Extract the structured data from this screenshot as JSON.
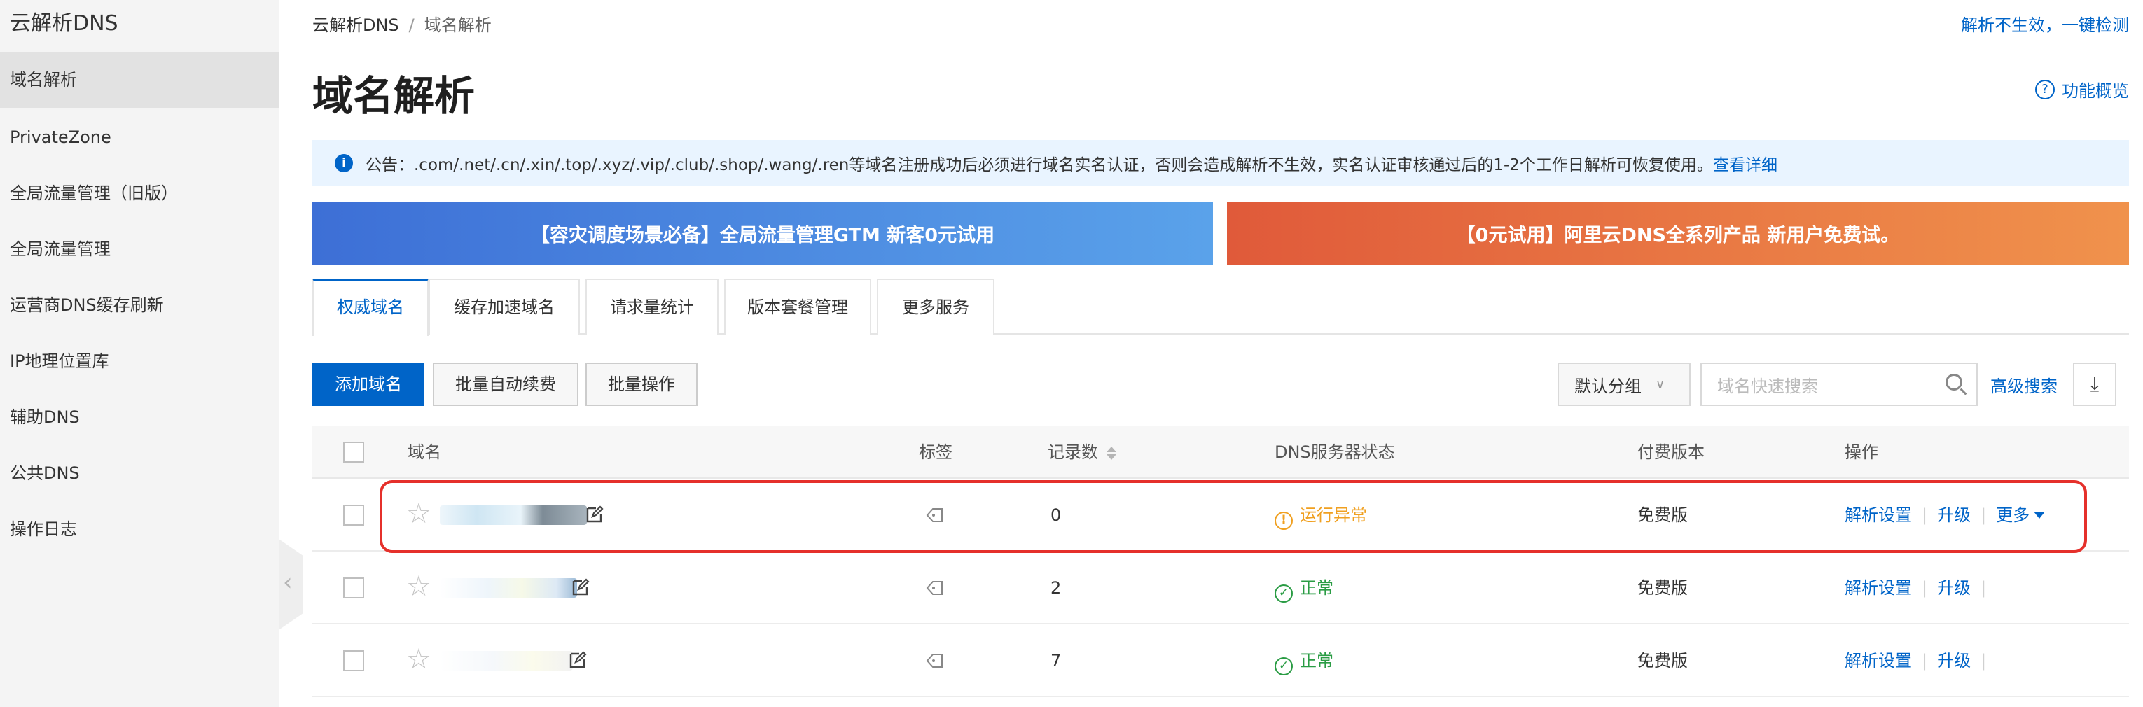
{
  "sidebar": {
    "title": "云解析DNS",
    "items": [
      {
        "label": "域名解析",
        "active": true
      },
      {
        "label": "PrivateZone"
      },
      {
        "label": "全局流量管理（旧版）"
      },
      {
        "label": "全局流量管理"
      },
      {
        "label": "运营商DNS缓存刷新"
      },
      {
        "label": "IP地理位置库"
      },
      {
        "label": "辅助DNS"
      },
      {
        "label": "公共DNS"
      },
      {
        "label": "操作日志"
      }
    ],
    "collapse_glyph": "‹"
  },
  "header": {
    "breadcrumb": [
      "云解析DNS",
      "域名解析"
    ],
    "breadcrumb_sep": "/",
    "top_link": "解析不生效，一键检测",
    "title": "域名解析",
    "overview_link": "功能概览"
  },
  "notice": {
    "text": "公告：.com/.net/.cn/.xin/.top/.xyz/.vip/.club/.shop/.wang/.ren等域名注册成功后必须进行域名实名认证，否则会造成解析不生效，实名认证审核通过后的1-2个工作日解析可恢复使用。",
    "link": "查看详细"
  },
  "banners": [
    {
      "text": "【容灾调度场景必备】全局流量管理GTM 新客0元试用"
    },
    {
      "text": "【0元试用】阿里云DNS全系列产品 新用户免费试。"
    }
  ],
  "tabs": [
    {
      "label": "权威域名",
      "active": true
    },
    {
      "label": "缓存加速域名"
    },
    {
      "label": "请求量统计"
    },
    {
      "label": "版本套餐管理"
    },
    {
      "label": "更多服务"
    }
  ],
  "toolbar": {
    "add_domain": "添加域名",
    "batch_renew": "批量自动续费",
    "batch_ops": "批量操作",
    "group_select": "默认分组",
    "search_placeholder": "域名快速搜索",
    "advanced_search": "高级搜索"
  },
  "table": {
    "columns": [
      "域名",
      "标签",
      "记录数",
      "DNS服务器状态",
      "付费版本",
      "操作"
    ],
    "rows": [
      {
        "records": "0",
        "status": "运行异常",
        "status_type": "warning",
        "plan": "免费版",
        "ops": [
          "解析设置",
          "升级",
          "更多"
        ],
        "highlighted": true
      },
      {
        "records": "2",
        "status": "正常",
        "status_type": "ok",
        "plan": "免费版",
        "ops": [
          "解析设置",
          "升级"
        ]
      },
      {
        "records": "7",
        "status": "正常",
        "status_type": "ok",
        "plan": "免费版",
        "ops": [
          "解析设置",
          "升级"
        ]
      }
    ]
  },
  "colors": {
    "primary": "#0064c8",
    "warning": "#f0a020",
    "ok": "#2a9c44",
    "highlight": "#e5302b"
  },
  "icons": {
    "info": "i",
    "question": "?",
    "star": "☆",
    "warning": "!",
    "check": "✓",
    "download": "⤓",
    "chevron": "∨"
  }
}
